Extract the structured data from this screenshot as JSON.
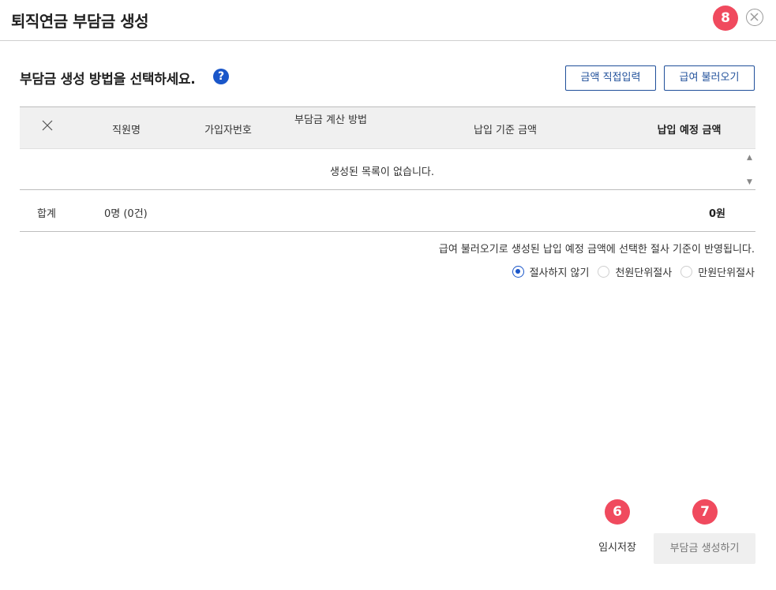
{
  "header": {
    "title": "퇴직연금 부담금 생성",
    "close_icon": "close-circle-icon"
  },
  "badges": {
    "close": "8",
    "temp_save": "6",
    "create": "7"
  },
  "method": {
    "title": "부담금 생성 방법을 선택하세요.",
    "help_icon": "?",
    "direct_input_label": "금액 직접입력",
    "load_salary_label": "급여 불러오기"
  },
  "table": {
    "columns": [
      "직원명",
      "가입자번호",
      "부담금 계산 방법",
      "납입 기준 금액",
      "납입 예정 금액"
    ],
    "empty_message": "생성된 목록이 없습니다.",
    "footer": {
      "label": "합계",
      "count": "0명 (0건)",
      "total": "0원"
    }
  },
  "rounding": {
    "notice": "급여 불러오기로 생성된 납입 예정 금액에 선택한 절사 기준이 반영됩니다.",
    "options": [
      "절사하지 않기",
      "천원단위절사",
      "만원단위절사"
    ],
    "selected": "절사하지 않기"
  },
  "actions": {
    "temp_save_label": "임시저장",
    "create_label": "부담금 생성하기"
  },
  "colors": {
    "accent": "#1a56c9",
    "badge": "#f04a5e",
    "button_border": "#1f4f9a"
  }
}
